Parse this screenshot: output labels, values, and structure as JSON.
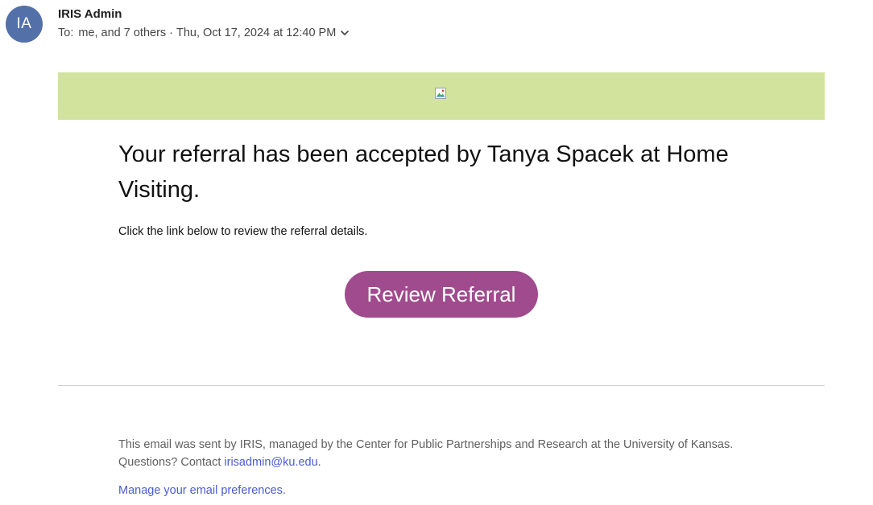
{
  "sender": {
    "initials": "IA",
    "name": "IRIS Admin",
    "avatar_color": "#5470a8"
  },
  "recipients": {
    "to_label": "To:",
    "list": "me, and 7 others",
    "separator": "·",
    "date": "Thu, Oct 17, 2024 at 12:40 PM"
  },
  "banner": {
    "color": "#d2e39e",
    "image_icon": "broken-image-icon"
  },
  "message": {
    "headline": "Your referral has been accepted by Tanya Spacek at Home Visiting.",
    "instruction": "Click the link below to review the referral details.",
    "cta_label": "Review Referral",
    "cta_color": "#a04b8d"
  },
  "footer": {
    "line1": "This email was sent by IRIS, managed by the Center for Public Partnerships and Research at the University of Kansas.",
    "questions_prefix": "Questions? Contact ",
    "contact_email": "irisadmin@ku.edu",
    "questions_suffix": ".",
    "preferences_link": "Manage your email preferences.",
    "link_color": "#4a5bd4"
  }
}
